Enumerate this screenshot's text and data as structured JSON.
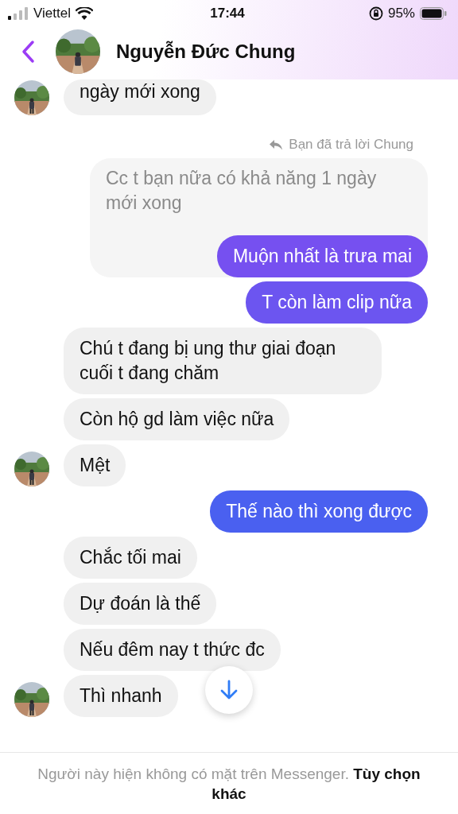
{
  "status_bar": {
    "carrier": "Viettel",
    "time": "17:44",
    "battery": "95%"
  },
  "header": {
    "name": "Nguyễn Đức Chung"
  },
  "messages": [
    {
      "kind": "received",
      "text": "ngày mới xong",
      "avatar": true,
      "cut_top": true
    },
    {
      "kind": "reply_note",
      "text": "Bạn đã trả lời Chung"
    },
    {
      "kind": "quoted",
      "text": "Cc t bạn nữa có khả năng 1 ngày mới xong"
    },
    {
      "kind": "sent",
      "text": "Muộn nhất là trưa mai",
      "color": "#7650f0"
    },
    {
      "kind": "sent",
      "text": "T còn làm clip nữa",
      "color": "#6c55f0"
    },
    {
      "kind": "received",
      "text": "Chú t đang bị ung thư giai đoạn cuối t đang chăm",
      "avatar": false
    },
    {
      "kind": "received",
      "text": "Còn hộ gd làm việc nữa",
      "avatar": false
    },
    {
      "kind": "received",
      "text": "Mệt",
      "avatar": true
    },
    {
      "kind": "sent",
      "text": "Thế nào thì xong được",
      "color": "#4a60f0"
    },
    {
      "kind": "received",
      "text": "Chắc tối mai",
      "avatar": false
    },
    {
      "kind": "received",
      "text": "Dự đoán là thế",
      "avatar": false
    },
    {
      "kind": "received",
      "text": "Nếu đêm nay t thức đc",
      "avatar": false
    },
    {
      "kind": "received",
      "text": "Thì nhanh",
      "avatar": true
    }
  ],
  "footer": {
    "note": "Người này hiện không có mặt trên Messenger. **Tùy chọn khác**"
  }
}
